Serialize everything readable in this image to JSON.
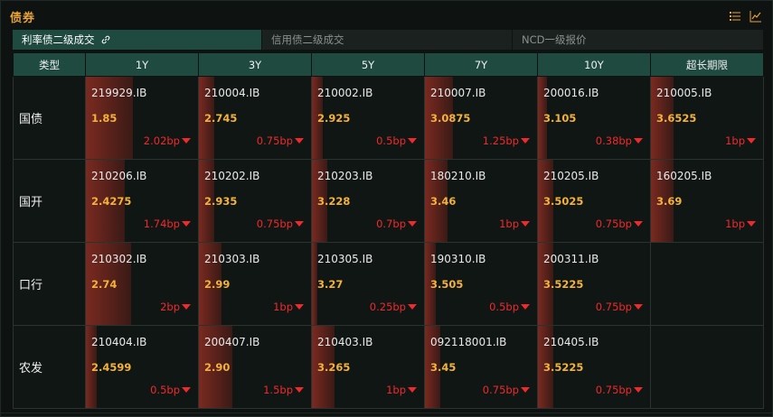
{
  "panel": {
    "title": "债券",
    "icons": [
      "list-icon",
      "line-chart-icon"
    ]
  },
  "tabs": [
    {
      "label": "利率债二级成交",
      "active": true
    },
    {
      "label": "信用债二级成交",
      "active": false
    },
    {
      "label": "NCD一级报价",
      "active": false
    }
  ],
  "table": {
    "headers": [
      "类型",
      "1Y",
      "3Y",
      "5Y",
      "7Y",
      "10Y",
      "超长期限"
    ],
    "rows": [
      {
        "type": "国债",
        "cells": [
          {
            "code": "219929.IB",
            "yield": "1.85",
            "change": "2.02bp",
            "dir": "down",
            "bar": 0.42
          },
          {
            "code": "210004.IB",
            "yield": "2.745",
            "change": "0.75bp",
            "dir": "down",
            "bar": 0.14
          },
          {
            "code": "210002.IB",
            "yield": "2.925",
            "change": "0.5bp",
            "dir": "down",
            "bar": 0.1
          },
          {
            "code": "210007.IB",
            "yield": "3.0875",
            "change": "1.25bp",
            "dir": "down",
            "bar": 0.25
          },
          {
            "code": "200016.IB",
            "yield": "3.105",
            "change": "0.38bp",
            "dir": "down",
            "bar": 0.08
          },
          {
            "code": "210005.IB",
            "yield": "3.6525",
            "change": "1bp",
            "dir": "down",
            "bar": 0.2
          }
        ]
      },
      {
        "type": "国开",
        "cells": [
          {
            "code": "210206.IB",
            "yield": "2.4275",
            "change": "1.74bp",
            "dir": "down",
            "bar": 0.35
          },
          {
            "code": "210202.IB",
            "yield": "2.935",
            "change": "0.75bp",
            "dir": "down",
            "bar": 0.14
          },
          {
            "code": "210203.IB",
            "yield": "3.228",
            "change": "0.7bp",
            "dir": "down",
            "bar": 0.14
          },
          {
            "code": "180210.IB",
            "yield": "3.46",
            "change": "1bp",
            "dir": "down",
            "bar": 0.2
          },
          {
            "code": "210205.IB",
            "yield": "3.5025",
            "change": "0.75bp",
            "dir": "down",
            "bar": 0.14
          },
          {
            "code": "160205.IB",
            "yield": "3.69",
            "change": "1bp",
            "dir": "down",
            "bar": 0.2
          }
        ]
      },
      {
        "type": "口行",
        "cells": [
          {
            "code": "210302.IB",
            "yield": "2.74",
            "change": "2bp",
            "dir": "down",
            "bar": 0.4
          },
          {
            "code": "210303.IB",
            "yield": "2.99",
            "change": "1bp",
            "dir": "down",
            "bar": 0.2
          },
          {
            "code": "210305.IB",
            "yield": "3.27",
            "change": "0.25bp",
            "dir": "down",
            "bar": 0.05
          },
          {
            "code": "190310.IB",
            "yield": "3.505",
            "change": "0.5bp",
            "dir": "down",
            "bar": 0.1
          },
          {
            "code": "200311.IB",
            "yield": "3.5225",
            "change": "0.75bp",
            "dir": "down",
            "bar": 0.14
          },
          null
        ]
      },
      {
        "type": "农发",
        "cells": [
          {
            "code": "210404.IB",
            "yield": "2.4599",
            "change": "0.5bp",
            "dir": "down",
            "bar": 0.1
          },
          {
            "code": "200407.IB",
            "yield": "2.90",
            "change": "1.5bp",
            "dir": "down",
            "bar": 0.3
          },
          {
            "code": "210403.IB",
            "yield": "3.265",
            "change": "1bp",
            "dir": "down",
            "bar": 0.2
          },
          {
            "code": "092118001.IB",
            "yield": "3.45",
            "change": "0.75bp",
            "dir": "down",
            "bar": 0.14
          },
          {
            "code": "210405.IB",
            "yield": "3.5225",
            "change": "0.75bp",
            "dir": "down",
            "bar": 0.14
          },
          null
        ]
      }
    ]
  },
  "colors": {
    "accent": "#e8a33a",
    "header_bg": "#1e4a40",
    "down": "#f0292b",
    "yield_text": "#f5b23a"
  }
}
